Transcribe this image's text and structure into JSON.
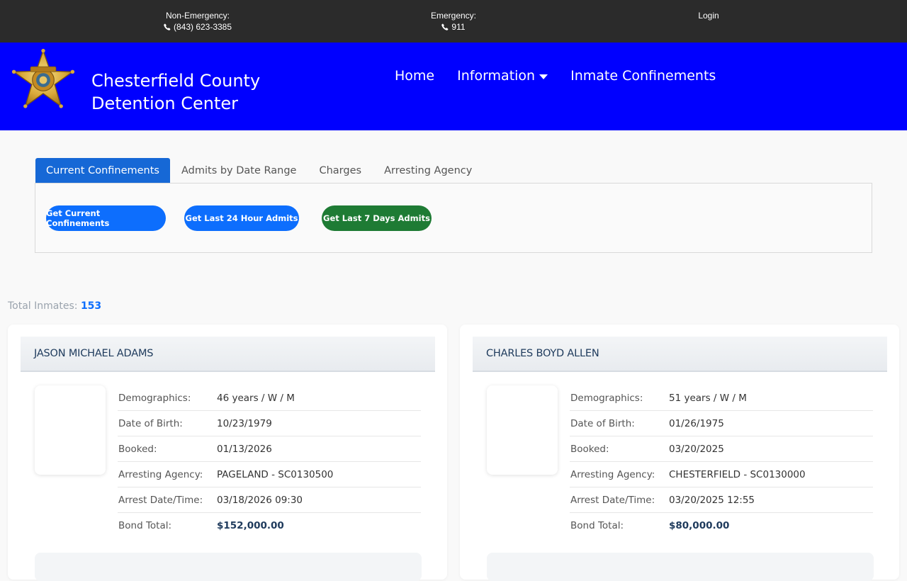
{
  "topbar": {
    "non_emergency_label": "Non-Emergency:",
    "non_emergency_phone": "(843) 623-3385",
    "emergency_label": "Emergency:",
    "emergency_phone": "911",
    "login": "Login"
  },
  "header": {
    "title": "Chesterfield County Detention Center",
    "nav": {
      "home": "Home",
      "information": "Information",
      "inmate_confinements": "Inmate Confinements"
    }
  },
  "tabs": [
    "Current Confinements",
    "Admits by Date Range",
    "Charges",
    "Arresting Agency"
  ],
  "buttons": {
    "current": "Get Current Confinements",
    "last24": "Get Last 24 Hour Admits",
    "last7": "Get Last 7 Days Admits"
  },
  "summary": {
    "label": "Total Inmates:",
    "count": "153"
  },
  "labels": {
    "demographics": "Demographics:",
    "dob": "Date of Birth:",
    "booked": "Booked:",
    "agency": "Arresting Agency:",
    "arrest": "Arrest Date/Time:",
    "bond": "Bond Total:"
  },
  "inmates": [
    {
      "name": "JASON MICHAEL ADAMS",
      "demographics": "46 years / W / M",
      "dob": "10/23/1979",
      "booked": "01/13/2026",
      "agency": "PAGELAND - SC0130500",
      "arrest": "03/18/2026 09:30",
      "bond": "$152,000.00"
    },
    {
      "name": "CHARLES BOYD ALLEN",
      "demographics": "51 years / W / M",
      "dob": "01/26/1975",
      "booked": "03/20/2025",
      "agency": "CHESTERFIELD - SC0130000",
      "arrest": "03/20/2025 12:55",
      "bond": "$80,000.00"
    }
  ],
  "colors": {
    "header_bg": "#0000ff",
    "topbar_bg": "#2b2b2b",
    "active_tab": "#1668d6",
    "blue_button": "#0d6efd",
    "green_button": "#1e7b34"
  }
}
